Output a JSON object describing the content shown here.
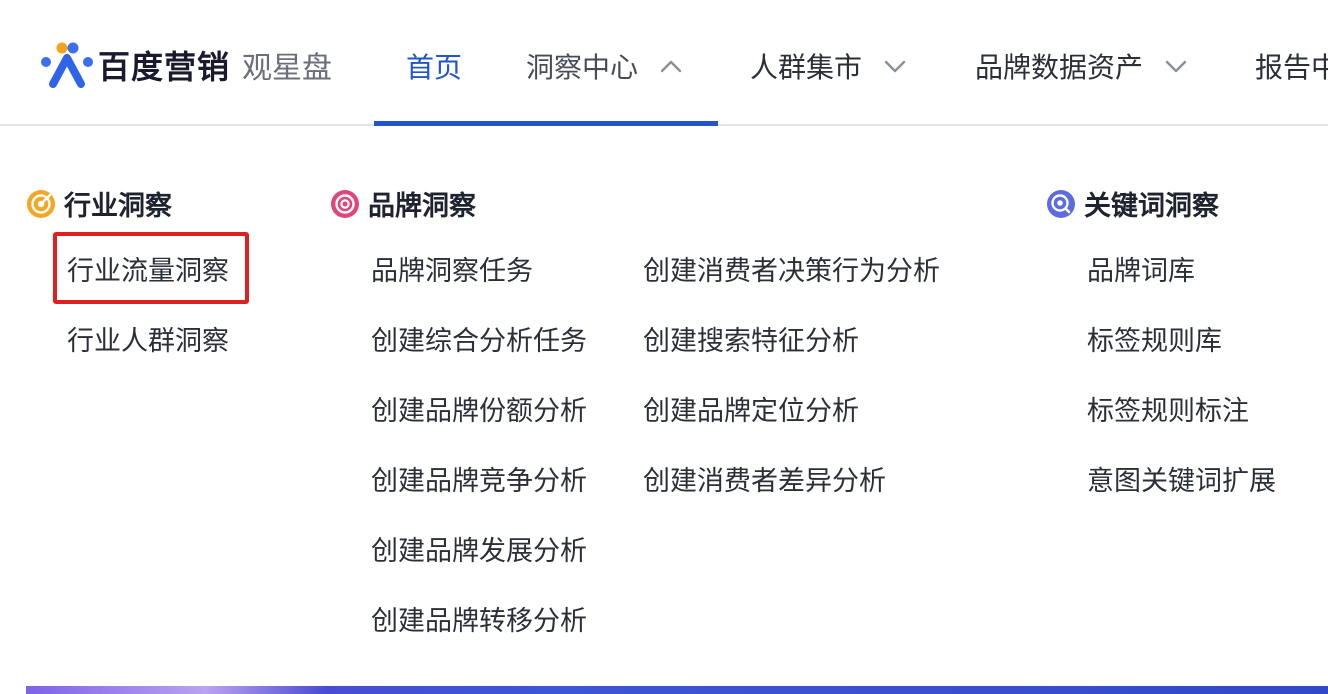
{
  "brand": {
    "name": "百度营销",
    "product": "观星盘",
    "logo_icon": "baidu-marketing-logo-icon",
    "colors": {
      "accent": "#2155c9",
      "highlight": "#e02020"
    }
  },
  "nav": {
    "items": [
      {
        "label": "首页",
        "state": "active"
      },
      {
        "label": "洞察中心",
        "state": "open",
        "chevron": "chevron-up-icon"
      },
      {
        "label": "人群集市",
        "chevron": "chevron-down-icon"
      },
      {
        "label": "品牌数据资产",
        "chevron": "chevron-down-icon"
      },
      {
        "label": "报告中"
      }
    ]
  },
  "menu": {
    "industry": {
      "title": "行业洞察",
      "icon": "industry-insight-icon",
      "links": [
        "行业流量洞察",
        "行业人群洞察"
      ],
      "highlighted": "行业流量洞察"
    },
    "brand": {
      "title": "品牌洞察",
      "icon": "brand-insight-icon",
      "col1": [
        "品牌洞察任务",
        "创建综合分析任务",
        "创建品牌份额分析",
        "创建品牌竞争分析",
        "创建品牌发展分析",
        "创建品牌转移分析"
      ],
      "col2": [
        "创建消费者决策行为分析",
        "创建搜索特征分析",
        "创建品牌定位分析",
        "创建消费者差异分析"
      ]
    },
    "keyword": {
      "title": "关键词洞察",
      "icon": "keyword-insight-icon",
      "links": [
        "品牌词库",
        "标签规则库",
        "标签规则标注",
        "意图关键词扩展"
      ]
    }
  }
}
